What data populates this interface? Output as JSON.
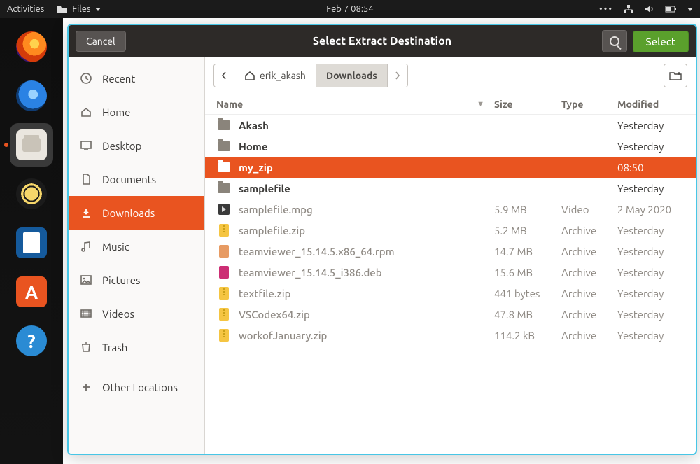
{
  "sysbar": {
    "activities": "Activities",
    "files_label": "Files",
    "datetime": "Feb 7  08:54"
  },
  "dialog": {
    "cancel": "Cancel",
    "title": "Select Extract Destination",
    "select": "Select"
  },
  "sidebar": {
    "items": [
      {
        "icon": "clock",
        "label": "Recent"
      },
      {
        "icon": "home",
        "label": "Home"
      },
      {
        "icon": "desktop",
        "label": "Desktop"
      },
      {
        "icon": "doc",
        "label": "Documents"
      },
      {
        "icon": "download",
        "label": "Downloads"
      },
      {
        "icon": "music",
        "label": "Music"
      },
      {
        "icon": "picture",
        "label": "Pictures"
      },
      {
        "icon": "video",
        "label": "Videos"
      },
      {
        "icon": "trash",
        "label": "Trash"
      }
    ],
    "other": "Other Locations"
  },
  "path": {
    "home": "erik_akash",
    "current": "Downloads"
  },
  "columns": {
    "name": "Name",
    "size": "Size",
    "type": "Type",
    "modified": "Modified"
  },
  "files": [
    {
      "icon": "folder",
      "name": "Akash",
      "size": "",
      "type": "",
      "modified": "Yesterday",
      "dim": false,
      "sel": false
    },
    {
      "icon": "folder",
      "name": "Home",
      "size": "",
      "type": "",
      "modified": "Yesterday",
      "dim": false,
      "sel": false
    },
    {
      "icon": "folder",
      "name": "my_zip",
      "size": "",
      "type": "",
      "modified": "08:50",
      "dim": false,
      "sel": true
    },
    {
      "icon": "folder",
      "name": "samplefile",
      "size": "",
      "type": "",
      "modified": "Yesterday",
      "dim": false,
      "sel": false
    },
    {
      "icon": "play",
      "name": "samplefile.mpg",
      "size": "5.9 MB",
      "type": "Video",
      "modified": "2 May 2020",
      "dim": true,
      "sel": false
    },
    {
      "icon": "zip",
      "name": "samplefile.zip",
      "size": "5.2 MB",
      "type": "Archive",
      "modified": "Yesterday",
      "dim": true,
      "sel": false
    },
    {
      "icon": "rpm",
      "name": "teamviewer_15.14.5.x86_64.rpm",
      "size": "14.7 MB",
      "type": "Archive",
      "modified": "Yesterday",
      "dim": true,
      "sel": false
    },
    {
      "icon": "deb",
      "name": "teamviewer_15.14.5_i386.deb",
      "size": "15.6 MB",
      "type": "Archive",
      "modified": "Yesterday",
      "dim": true,
      "sel": false
    },
    {
      "icon": "zip",
      "name": "textfile.zip",
      "size": "441 bytes",
      "type": "Archive",
      "modified": "Yesterday",
      "dim": true,
      "sel": false
    },
    {
      "icon": "zip",
      "name": "VSCodex64.zip",
      "size": "47.8 MB",
      "type": "Archive",
      "modified": "Yesterday",
      "dim": true,
      "sel": false
    },
    {
      "icon": "zip",
      "name": "workofJanuary.zip",
      "size": "114.2 kB",
      "type": "Archive",
      "modified": "Yesterday",
      "dim": true,
      "sel": false
    }
  ]
}
